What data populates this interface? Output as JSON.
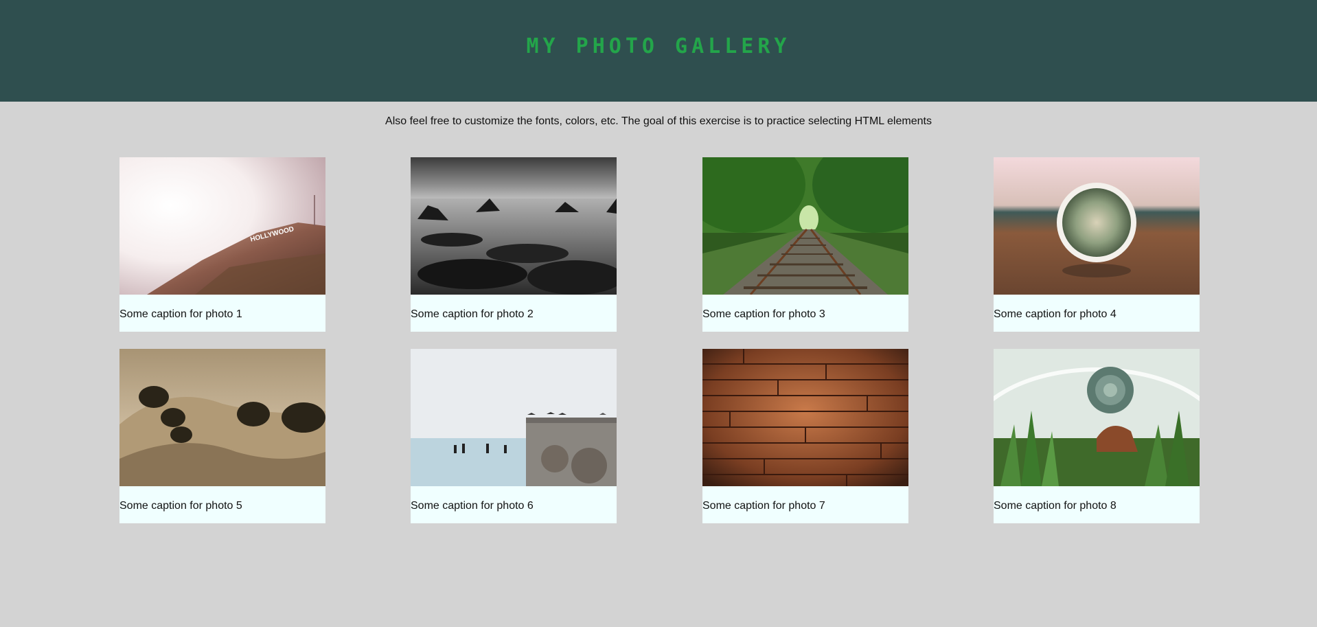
{
  "header": {
    "title": "My Photo Gallery"
  },
  "intro": {
    "text": "Also feel free to customize the fonts, colors, etc. The goal of this exercise is to practice selecting HTML elements"
  },
  "photos": [
    {
      "caption": "Some caption for photo 1",
      "image": "hollywood-hills-photo",
      "sign_text": "HOLLYWOOD"
    },
    {
      "caption": "Some caption for photo 2",
      "image": "rocky-coast-photo"
    },
    {
      "caption": "Some caption for photo 3",
      "image": "railway-tracks-photo"
    },
    {
      "caption": "Some caption for photo 4",
      "image": "cactus-photo"
    },
    {
      "caption": "Some caption for photo 5",
      "image": "oak-hills-photo"
    },
    {
      "caption": "Some caption for photo 6",
      "image": "seaside-birds-photo"
    },
    {
      "caption": "Some caption for photo 7",
      "image": "wood-planks-photo"
    },
    {
      "caption": "Some caption for photo 8",
      "image": "terrarium-photo"
    }
  ],
  "colors": {
    "header_bg": "#2f4f4f",
    "title": "#23a54a",
    "page_bg": "#d3d3d3",
    "card_bg": "#f0ffff"
  }
}
